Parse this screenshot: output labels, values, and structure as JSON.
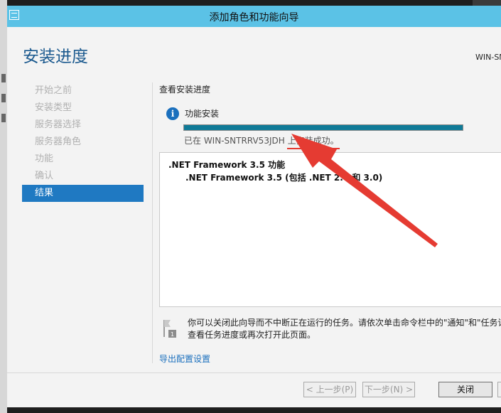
{
  "window": {
    "title": "添加角色和功能向导"
  },
  "header": {
    "page_title": "安装进度",
    "server_name": "WIN-SN"
  },
  "nav": {
    "items": [
      {
        "label": "开始之前",
        "active": false
      },
      {
        "label": "安装类型",
        "active": false
      },
      {
        "label": "服务器选择",
        "active": false
      },
      {
        "label": "服务器角色",
        "active": false
      },
      {
        "label": "功能",
        "active": false
      },
      {
        "label": "确认",
        "active": false
      },
      {
        "label": "结果",
        "active": true
      }
    ]
  },
  "main": {
    "section_title": "查看安装进度",
    "feature_label": "功能安装",
    "progress": 1.0,
    "status_text": "已在 WIN-SNTRRV53JDH 上安装成功。",
    "results": [
      ".NET Framework 3.5 功能",
      ".NET Framework 3.5 (包括 .NET 2.0 和 3.0)"
    ],
    "note_line1": "你可以关闭此向导而不中断正在运行的任务。请依次单击命令栏中的\"通知\"和\"任务详",
    "note_line2": "查看任务进度或再次打开此页面。",
    "export_link": "导出配置设置"
  },
  "footer": {
    "prev_label": "< 上一步(P)",
    "next_label": "下一步(N) >",
    "close_label": "关闭"
  },
  "colors": {
    "titlebar": "#5bc2e6",
    "nav_active": "#1f79c2",
    "progress": "#0f7a97",
    "annotation": "#e53b32",
    "link": "#1a6fbd"
  }
}
